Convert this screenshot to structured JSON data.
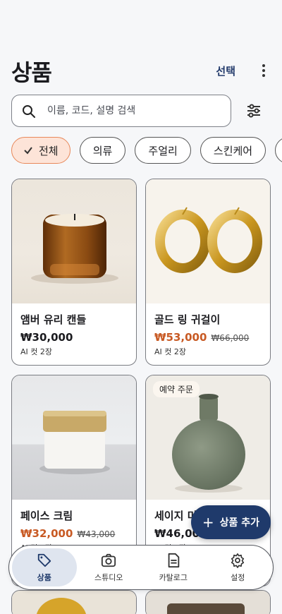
{
  "header": {
    "title": "상품",
    "select_label": "선택"
  },
  "search": {
    "placeholder": "이름, 코드, 설명 검색"
  },
  "filters": [
    {
      "label": "전체",
      "active": true
    },
    {
      "label": "의류",
      "active": false
    },
    {
      "label": "주얼리",
      "active": false
    },
    {
      "label": "스킨케어",
      "active": false
    },
    {
      "label": "",
      "active": false
    }
  ],
  "products": [
    {
      "name": "앰버 유리 캔들",
      "price": "₩30,000",
      "original_price": "",
      "meta": "AI 컷 2장",
      "badge": "",
      "on_sale": false
    },
    {
      "name": "골드 링 귀걸이",
      "price": "₩53,000",
      "original_price": "₩66,000",
      "meta": "AI 컷 2장",
      "badge": "",
      "on_sale": true
    },
    {
      "name": "페이스 크림",
      "price": "₩32,000",
      "original_price": "₩43,000",
      "meta": "AI 컷 2장",
      "badge": "",
      "on_sale": true
    },
    {
      "name": "세이지 미",
      "price": "₩46,00",
      "original_price": "",
      "meta": "AI 컷 2장",
      "badge": "예약 주문",
      "on_sale": false
    }
  ],
  "fab": {
    "label": "상품 추가"
  },
  "nav": [
    {
      "label": "상품",
      "icon": "tag-icon",
      "active": true
    },
    {
      "label": "스튜디오",
      "icon": "camera-icon",
      "active": false
    },
    {
      "label": "카탈로그",
      "icon": "document-icon",
      "active": false
    },
    {
      "label": "설정",
      "icon": "gear-icon",
      "active": false
    }
  ],
  "colors": {
    "accent": "#1f3a6b",
    "sale": "#c85a24",
    "chip_active_bg": "#fde4d8"
  }
}
